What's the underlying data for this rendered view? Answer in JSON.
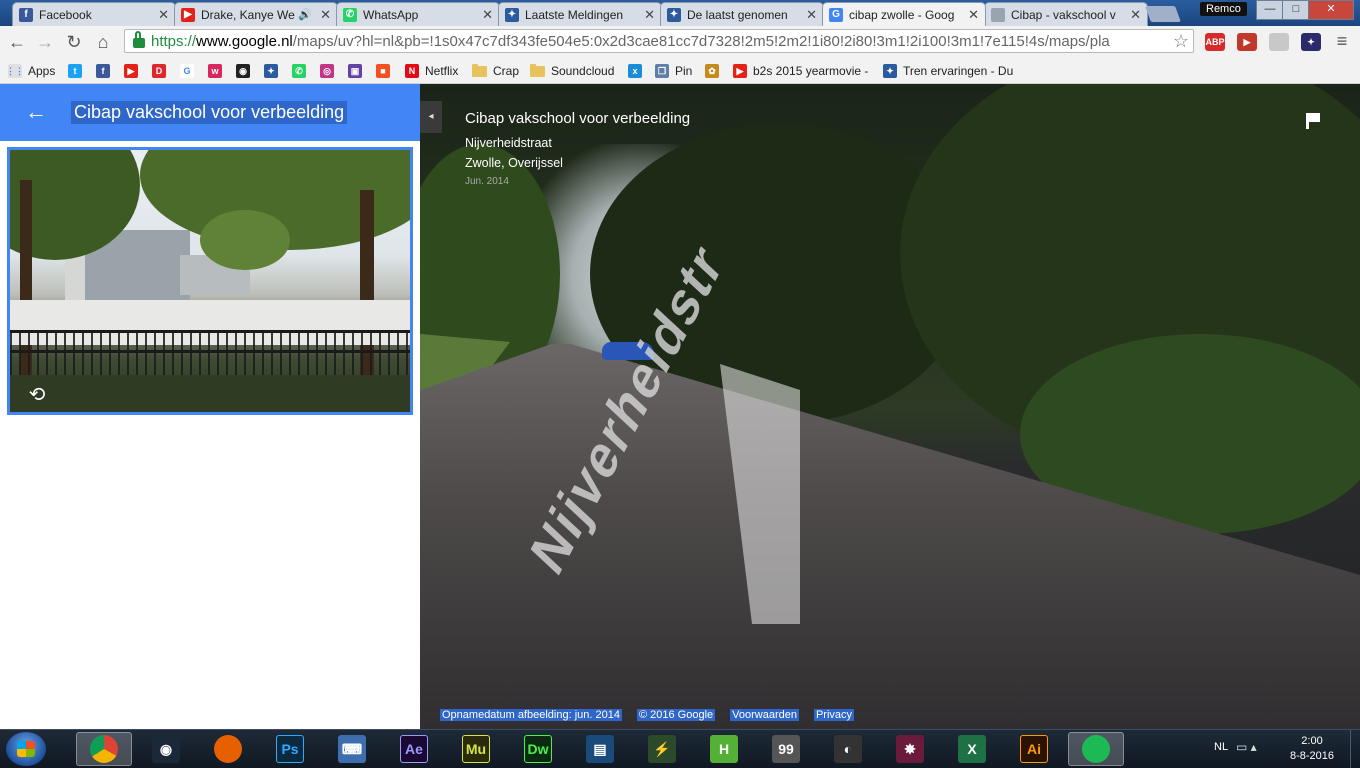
{
  "browser": {
    "tabs": [
      {
        "label": "Facebook",
        "favicon": "facebook-icon",
        "color": "#3b5998",
        "glyph": "f"
      },
      {
        "label": "Drake, Kanye We",
        "favicon": "youtube-icon",
        "color": "#e62117",
        "glyph": "▶",
        "audio": "🔊"
      },
      {
        "label": "WhatsApp",
        "favicon": "whatsapp-icon",
        "color": "#25d366",
        "glyph": "✆"
      },
      {
        "label": "Laatste Meldingen",
        "favicon": "site-icon",
        "color": "#2a5b9e",
        "glyph": "✦"
      },
      {
        "label": "De laatst genomen",
        "favicon": "site-icon",
        "color": "#2a5b9e",
        "glyph": "✦"
      },
      {
        "label": "cibap zwolle - Goog",
        "favicon": "google-icon",
        "color": "#4285f4",
        "glyph": "G"
      },
      {
        "label": "Cibap - vakschool v",
        "favicon": "page-icon",
        "color": "#9aa4b0",
        "glyph": ""
      }
    ],
    "close_glyph": "✕",
    "profile_name": "Remco",
    "window_controls": {
      "minimize": "—",
      "maximize": "□",
      "close": "✕"
    },
    "nav": {
      "back": "←",
      "forward": "→",
      "reload": "↻",
      "home": "⌂"
    },
    "url": {
      "scheme": "https://",
      "host": "www.google.nl",
      "path": "/maps/uv?hl=nl&pb=!1s0x47c7df343fe504e5:0x2d3cae81cc7d7328!2m5!2m2!1i80!2i80!3m1!2i100!3m1!7e115!4s/maps/pla"
    },
    "star_glyph": "☆",
    "extensions": [
      {
        "name": "adblock-plus-icon",
        "label": "ABP",
        "color": "#d72b2b"
      },
      {
        "name": "youtube-ext-icon",
        "label": "▶",
        "color": "#c0392b"
      },
      {
        "name": "blank-ext-icon",
        "label": "",
        "color": "#c8c8c8"
      },
      {
        "name": "flag-ext-icon",
        "label": "✦",
        "color": "#2b2b6b"
      }
    ],
    "menu_glyph": "≡",
    "bookmarks": [
      {
        "label": "Apps",
        "icon": "apps-grid-icon",
        "color": "#e0e0e0",
        "glyph": "⋮⋮"
      },
      {
        "label": "",
        "icon": "twitter-icon",
        "color": "#1da1f2",
        "glyph": "t"
      },
      {
        "label": "",
        "icon": "facebook-icon",
        "color": "#3b5998",
        "glyph": "f"
      },
      {
        "label": "",
        "icon": "youtube-icon",
        "color": "#e62117",
        "glyph": "▶"
      },
      {
        "label": "",
        "icon": "dumpert-icon",
        "color": "#e0262d",
        "glyph": "D"
      },
      {
        "label": "",
        "icon": "google-icon",
        "color": "#ffffff",
        "glyph": "G"
      },
      {
        "label": "",
        "icon": "web-icon",
        "color": "#d7275f",
        "glyph": "w"
      },
      {
        "label": "",
        "icon": "steam-icon",
        "color": "#222222",
        "glyph": "◉"
      },
      {
        "label": "",
        "icon": "site-icon",
        "color": "#2a5b9e",
        "glyph": "✦"
      },
      {
        "label": "",
        "icon": "whatsapp-icon",
        "color": "#25d366",
        "glyph": "✆"
      },
      {
        "label": "",
        "icon": "instagram-icon",
        "color": "#c13584",
        "glyph": "◎"
      },
      {
        "label": "",
        "icon": "twitch-icon",
        "color": "#6441a5",
        "glyph": "▣"
      },
      {
        "label": "",
        "icon": "microsoft-icon",
        "color": "#f25022",
        "glyph": "■"
      },
      {
        "label": "Netflix",
        "icon": "netflix-icon",
        "color": "#e50914",
        "glyph": "N"
      },
      {
        "label": "Crap",
        "icon": "folder-icon",
        "folder": true
      },
      {
        "label": "Soundcloud",
        "icon": "folder-icon",
        "folder": true
      },
      {
        "label": "",
        "icon": "x-icon",
        "color": "#1a8cd8",
        "glyph": "x"
      },
      {
        "label": "Pin",
        "icon": "pin-icon",
        "color": "#5f7fa8",
        "glyph": "❒"
      },
      {
        "label": "",
        "icon": "tiger-icon",
        "color": "#c48a1c",
        "glyph": "✿"
      },
      {
        "label": "b2s 2015 yearmovie -",
        "icon": "youtube-icon",
        "color": "#e62117",
        "glyph": "▶"
      },
      {
        "label": "Tren ervaringen - Du",
        "icon": "site-icon",
        "color": "#2a5b9e",
        "glyph": "✦"
      }
    ]
  },
  "maps": {
    "panel": {
      "back_glyph": "←",
      "title": "Cibap vakschool voor verbeelding",
      "rotate_glyph": "⟲"
    },
    "streetview": {
      "collapse_glyph": "◂",
      "title": "Cibap vakschool voor verbeelding",
      "street": "Nijverheidstraat",
      "city": "Zwolle, Overijssel",
      "date": "Jun. 2014",
      "painted_street_text": "Nijverheidstr",
      "footer": {
        "capture_date": "Opnamedatum afbeelding: jun. 2014",
        "copyright": "© 2016 Google",
        "terms": "Voorwaarden",
        "privacy": "Privacy"
      }
    }
  },
  "taskbar": {
    "apps": [
      {
        "name": "chrome-icon",
        "label": "",
        "bg": "#db4437",
        "active": true
      },
      {
        "name": "steam-icon",
        "label": "◉",
        "bg": "#1b2838"
      },
      {
        "name": "firefox-icon",
        "label": "",
        "bg": "#e66000"
      },
      {
        "name": "photoshop-icon",
        "label": "Ps",
        "bg": "#0b2a3f",
        "fg": "#31a8ff"
      },
      {
        "name": "keyboard-icon",
        "label": "⌨",
        "bg": "#3d6fb0"
      },
      {
        "name": "after-effects-icon",
        "label": "Ae",
        "bg": "#1a0a33",
        "fg": "#9999ff"
      },
      {
        "name": "muse-icon",
        "label": "Mu",
        "bg": "#2b2a0a",
        "fg": "#d6e64a"
      },
      {
        "name": "dreamweaver-icon",
        "label": "Dw",
        "bg": "#0a2b12",
        "fg": "#4bf04b"
      },
      {
        "name": "film-icon",
        "label": "▤",
        "bg": "#1a4a7a"
      },
      {
        "name": "game-icon",
        "label": "⚡",
        "bg": "#2a4a2a"
      },
      {
        "name": "h-app-icon",
        "label": "H",
        "bg": "#55b135"
      },
      {
        "name": "monitor-icon",
        "label": "99",
        "bg": "#555555"
      },
      {
        "name": "racing-icon",
        "label": "◐",
        "bg": "#333333"
      },
      {
        "name": "winamp-icon",
        "label": "✸",
        "bg": "#6a1a3a"
      },
      {
        "name": "excel-icon",
        "label": "X",
        "bg": "#1e7145"
      },
      {
        "name": "illustrator-icon",
        "label": "Ai",
        "bg": "#2b1300",
        "fg": "#ff9a00"
      },
      {
        "name": "spotify-icon",
        "label": "",
        "bg": "#1db954",
        "active": true
      }
    ],
    "language": "NL",
    "tray_glyphs": "▭ ▴",
    "time": "2:00",
    "date": "8-8-2016"
  }
}
